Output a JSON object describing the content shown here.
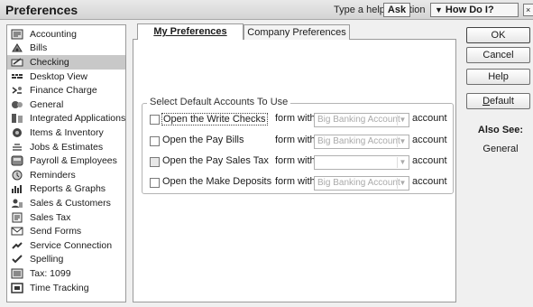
{
  "window": {
    "title": "Preferences",
    "help_question": "Type a help question",
    "ask_label": "Ask",
    "how_do_i_label": "How Do I?",
    "close_glyph": "×"
  },
  "sidebar": {
    "items": [
      {
        "label": "Accounting",
        "icon": "accounting-icon"
      },
      {
        "label": "Bills",
        "icon": "bills-icon"
      },
      {
        "label": "Checking",
        "icon": "checking-icon",
        "selected": true
      },
      {
        "label": "Desktop View",
        "icon": "desktop-view-icon"
      },
      {
        "label": "Finance Charge",
        "icon": "finance-charge-icon"
      },
      {
        "label": "General",
        "icon": "general-icon"
      },
      {
        "label": "Integrated Applications",
        "icon": "integrated-applications-icon"
      },
      {
        "label": "Items & Inventory",
        "icon": "items-inventory-icon"
      },
      {
        "label": "Jobs & Estimates",
        "icon": "jobs-estimates-icon"
      },
      {
        "label": "Payroll & Employees",
        "icon": "payroll-employees-icon"
      },
      {
        "label": "Reminders",
        "icon": "reminders-icon"
      },
      {
        "label": "Reports & Graphs",
        "icon": "reports-graphs-icon"
      },
      {
        "label": "Sales & Customers",
        "icon": "sales-customers-icon"
      },
      {
        "label": "Sales Tax",
        "icon": "sales-tax-icon"
      },
      {
        "label": "Send Forms",
        "icon": "send-forms-icon"
      },
      {
        "label": "Service Connection",
        "icon": "service-connection-icon"
      },
      {
        "label": "Spelling",
        "icon": "spelling-icon"
      },
      {
        "label": "Tax: 1099",
        "icon": "tax-1099-icon"
      },
      {
        "label": "Time Tracking",
        "icon": "time-tracking-icon"
      }
    ]
  },
  "tabs": {
    "my_preferences": "My Preferences",
    "company_preferences": "Company Preferences"
  },
  "group": {
    "title": "Select Default Accounts To Use",
    "form_with": "form with",
    "account_suffix": "account",
    "rows": [
      {
        "label": "Open the Write Checks",
        "value": "Big Banking Account",
        "checked": false,
        "focused": true
      },
      {
        "label": "Open the Pay Bills",
        "value": "Big Banking Account",
        "checked": false
      },
      {
        "label": "Open the Pay Sales Tax",
        "value": "",
        "checked": false
      },
      {
        "label": "Open the Make Deposits",
        "value": "Big Banking Account",
        "checked": false
      }
    ]
  },
  "buttons": {
    "ok": "OK",
    "cancel": "Cancel",
    "help": "Help",
    "default": "Default"
  },
  "also_see": {
    "title": "Also See:",
    "link": "General"
  }
}
